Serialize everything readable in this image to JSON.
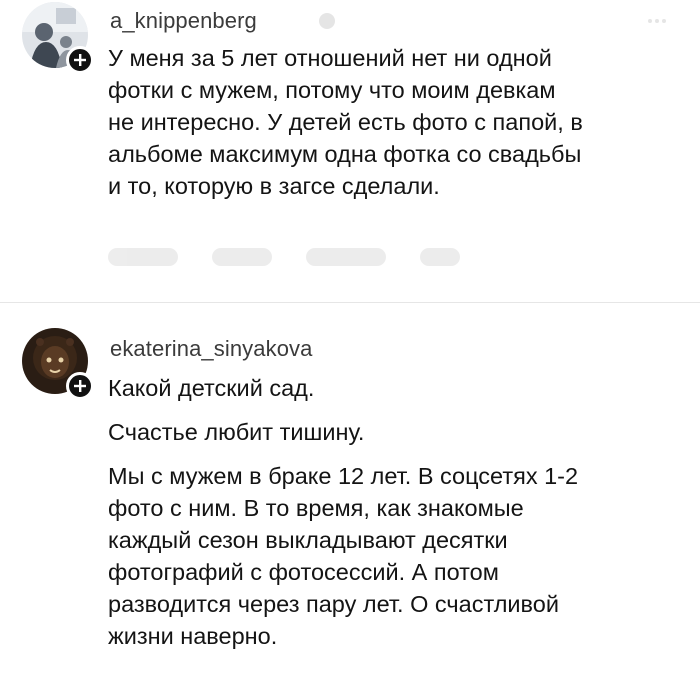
{
  "comments": [
    {
      "username": "a_knippenberg",
      "lines": [
        "У меня за 5 лет отношений нет ни одной",
        "фотки с мужем, потому что моим девкам",
        "не интересно. У детей есть фото с папой, в",
        "альбоме максимум одна фотка со свадьбы",
        "и то, которую в загсе сделали."
      ]
    },
    {
      "username": "ekaterina_sinyakova",
      "paragraphs": [
        [
          "Какой детский сад."
        ],
        [
          "Счастье любит тишину."
        ],
        [
          "Мы с мужем в браке 12 лет. В соцсетях 1-2",
          "фото с ним. В то время, как знакомые",
          "каждый сезон выкладывают десятки",
          "фотографий с фотосессий. А потом",
          "разводится через пару лет. О счастливой",
          "жизни наверно."
        ]
      ]
    }
  ],
  "icons": {
    "follow_badge": "plus-circle-icon",
    "faded_meta": "verified-icon",
    "faded_menu": "more-icon"
  },
  "colors": {
    "background": "#ffffff",
    "text": "#141414",
    "username": "#3b3b3b",
    "badge": "#111111"
  }
}
